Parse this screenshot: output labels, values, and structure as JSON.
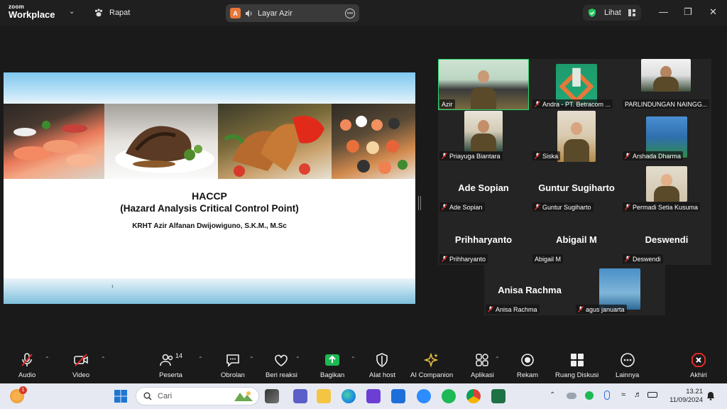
{
  "titlebar": {
    "logo_top": "zoom",
    "logo_bottom": "Workplace",
    "meeting_menu": "Rapat",
    "sharer_initial": "A",
    "sharer_label": "Layar Azir",
    "view_label": "Lihat"
  },
  "slide": {
    "title": "HACCP",
    "subtitle": "(Hazard Analysis Critical Control Point)",
    "author": "KRHT Azir Alfanan Dwijowiguno, S.K.M., M.Sc",
    "page_number": "1"
  },
  "participants": [
    {
      "label": "Azir",
      "display": "",
      "video": true,
      "muted": false,
      "active": true
    },
    {
      "label": "Andra - PT. Betracom ...",
      "display": "",
      "video": true,
      "muted": true
    },
    {
      "label": "PARLINDUNGAN NAINGG...",
      "display": "",
      "video": true,
      "muted": false
    },
    {
      "label": "Priayuga Biantara",
      "display": "",
      "video": true,
      "muted": true
    },
    {
      "label": "Siska",
      "display": "",
      "video": true,
      "muted": true
    },
    {
      "label": "Arshada Dharma",
      "display": "",
      "video": true,
      "muted": true
    },
    {
      "label": "Ade Sopian",
      "display": "Ade Sopian",
      "video": false,
      "muted": true
    },
    {
      "label": "Guntur Sugiharto",
      "display": "Guntur Sugiharto",
      "video": false,
      "muted": true
    },
    {
      "label": "Permadi Setia Kusuma",
      "display": "",
      "video": true,
      "muted": true
    },
    {
      "label": "Prihharyanto",
      "display": "Prihharyanto",
      "video": false,
      "muted": true
    },
    {
      "label": "Abigail M",
      "display": "Abigail M",
      "video": false,
      "muted": false
    },
    {
      "label": "Deswendi",
      "display": "Deswendi",
      "video": false,
      "muted": true
    },
    {
      "label": "Anisa Rachma",
      "display": "Anisa Rachma",
      "video": false,
      "muted": true
    },
    {
      "label": "agus januarta",
      "display": "",
      "video": true,
      "muted": true
    }
  ],
  "toolbar": {
    "audio": "Audio",
    "video": "Video",
    "participants": "Peserta",
    "participants_count": "14",
    "chat": "Obrolan",
    "reactions": "Beri reaksi",
    "share": "Bagikan",
    "host_tools": "Alat host",
    "ai_companion": "AI Companion",
    "apps": "Aplikasi",
    "record": "Rekam",
    "breakout": "Ruang Diskusi",
    "more": "Lainnya",
    "end": "Akhiri"
  },
  "taskbar": {
    "search_placeholder": "Cari",
    "time": "13.21",
    "date": "11/09/2024",
    "weather_badge": "1"
  },
  "colors": {
    "active_speaker": "#23d96c",
    "share_green": "#1db954",
    "end_red": "#e02828",
    "muted_red": "#e02828"
  }
}
